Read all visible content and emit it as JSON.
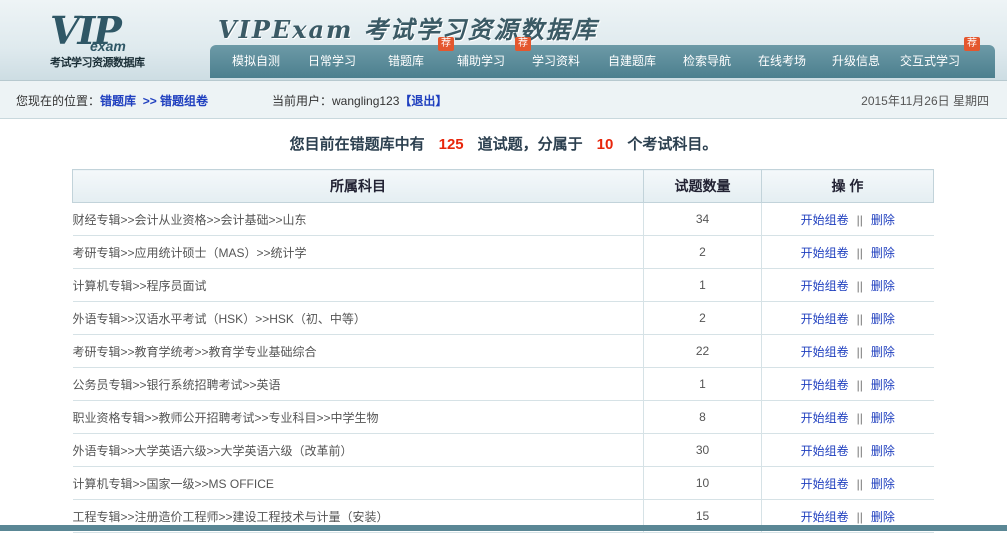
{
  "header": {
    "logo_vip": "VIP",
    "logo_exam": "exam",
    "logo_sub": "考试学习资源数据库",
    "title": "VIPExam 考试学习资源数据库"
  },
  "nav": {
    "items": [
      {
        "label": "模拟自测",
        "badge": ""
      },
      {
        "label": "日常学习",
        "badge": ""
      },
      {
        "label": "错题库",
        "badge": "荐"
      },
      {
        "label": "辅助学习",
        "badge": "荐"
      },
      {
        "label": "学习资料",
        "badge": ""
      },
      {
        "label": "自建题库",
        "badge": ""
      },
      {
        "label": "检索导航",
        "badge": ""
      },
      {
        "label": "在线考场",
        "badge": ""
      },
      {
        "label": "升级信息",
        "badge": ""
      },
      {
        "label": "交互式学习",
        "badge": "荐"
      }
    ]
  },
  "location": {
    "prefix": "您现在的位置：",
    "crumb1": "错题库",
    "crumb2": ">> 错题组卷",
    "user_label": "当前用户：",
    "user_name": "wangling123",
    "logout": "【退出】",
    "date": "2015年11月26日  星期四"
  },
  "summary": {
    "part1": "您目前在错题库中有",
    "count_questions": "125",
    "part2": "道试题，分属于",
    "count_subjects": "10",
    "part3": "个考试科目。"
  },
  "table": {
    "headers": [
      "所属科目",
      "试题数量",
      "操  作"
    ],
    "op_start": "开始组卷",
    "op_sep": "||",
    "op_delete": "删除",
    "rows": [
      {
        "subject": "财经专辑>>会计从业资格>>会计基础>>山东",
        "count": "34"
      },
      {
        "subject": "考研专辑>>应用统计硕士（MAS）>>统计学",
        "count": "2"
      },
      {
        "subject": "计算机专辑>>程序员面试",
        "count": "1"
      },
      {
        "subject": "外语专辑>>汉语水平考试（HSK）>>HSK（初、中等）",
        "count": "2"
      },
      {
        "subject": "考研专辑>>教育学统考>>教育学专业基础综合",
        "count": "22"
      },
      {
        "subject": "公务员专辑>>银行系统招聘考试>>英语",
        "count": "1"
      },
      {
        "subject": "职业资格专辑>>教师公开招聘考试>>专业科目>>中学生物",
        "count": "8"
      },
      {
        "subject": "外语专辑>>大学英语六级>>大学英语六级（改革前）",
        "count": "30"
      },
      {
        "subject": "计算机专辑>>国家一级>>MS OFFICE",
        "count": "10"
      },
      {
        "subject": "工程专辑>>注册造价工程师>>建设工程技术与计量（安装）",
        "count": "15"
      }
    ]
  }
}
